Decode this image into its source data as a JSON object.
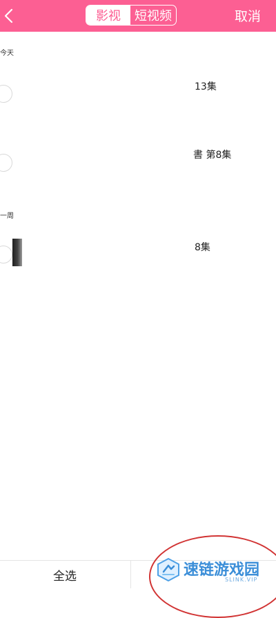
{
  "header": {
    "tabs": [
      {
        "label": "影视",
        "active": true
      },
      {
        "label": "短视频",
        "active": false
      }
    ],
    "cancel_label": "取消"
  },
  "sections": [
    {
      "label": "今天",
      "items": [
        {
          "episode_text": "13集",
          "selected": false
        },
        {
          "episode_text": "書 第8集",
          "selected": false
        }
      ]
    },
    {
      "label": "一周",
      "items": [
        {
          "episode_text": "8集",
          "selected": false
        }
      ]
    }
  ],
  "footer": {
    "select_all_label": "全选"
  },
  "watermark": {
    "title": "速链游戏园",
    "subtitle": "SLINK.VIP"
  },
  "colors": {
    "accent": "#fc5f93",
    "annotation_circle": "#d13333"
  }
}
